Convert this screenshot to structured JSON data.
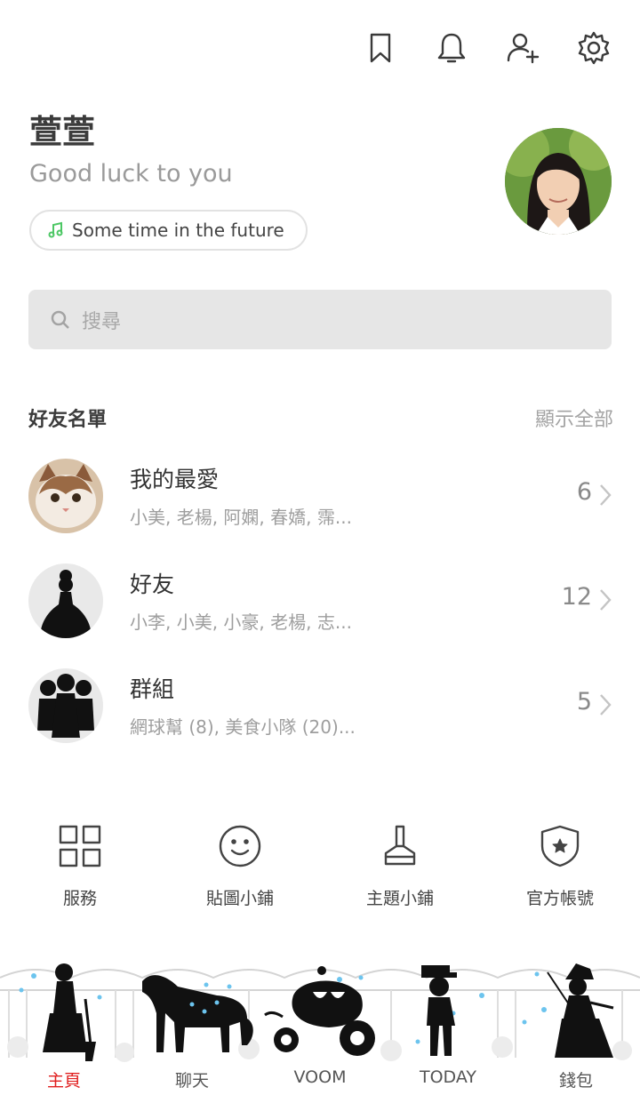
{
  "topbar": {
    "icons": [
      "bookmark-icon",
      "bell-icon",
      "add-friend-icon",
      "gear-icon"
    ]
  },
  "profile": {
    "name": "萱萱",
    "status": "Good luck to you",
    "music": "Some time in the future",
    "accent_color": "#4cc764"
  },
  "search": {
    "placeholder": "搜尋"
  },
  "friends": {
    "title": "好友名單",
    "show_all": "顯示全部",
    "rows": [
      {
        "name": "我的最愛",
        "members": "小美, 老楊, 阿嫻, 春嬌, 霈...",
        "count": "6"
      },
      {
        "name": "好友",
        "members": "小李, 小美, 小豪, 老楊, 志...",
        "count": "12"
      },
      {
        "name": "群組",
        "members": "網球幫 (8), 美食小隊 (20)...",
        "count": "5"
      }
    ]
  },
  "services": [
    {
      "label": "服務",
      "icon": "grid-icon"
    },
    {
      "label": "貼圖小鋪",
      "icon": "smiley-icon"
    },
    {
      "label": "主題小鋪",
      "icon": "brush-icon"
    },
    {
      "label": "官方帳號",
      "icon": "shield-star-icon"
    }
  ],
  "nav": {
    "tabs": [
      "主頁",
      "聊天",
      "VOOM",
      "TODAY",
      "錢包"
    ],
    "active_color": "#e02020"
  }
}
